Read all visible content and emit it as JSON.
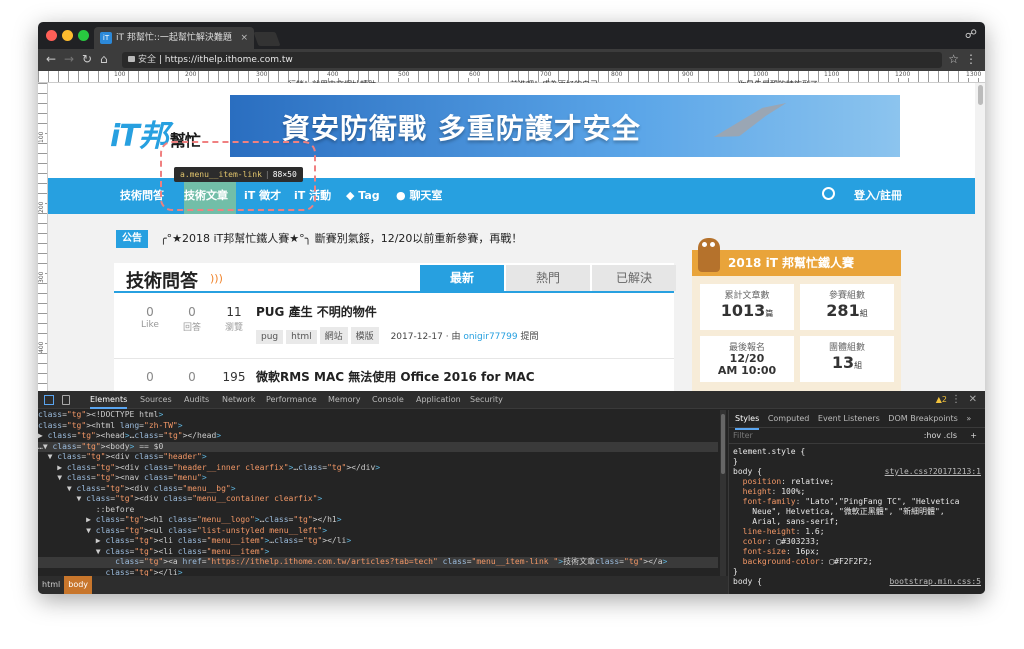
{
  "browser": {
    "tab_title": "iT 邦幫忙::一起幫忙解決難題",
    "url_secure": "安全",
    "url": "https://ithelp.ithome.com.tw",
    "traffic_colors": [
      "#ff5f57",
      "#febc2e",
      "#28c840"
    ]
  },
  "ruler": {
    "top_marks": [
      "100",
      "200",
      "300",
      "400",
      "500",
      "600",
      "700",
      "800",
      "900",
      "1000",
      "1100",
      "1200",
      "1300"
    ],
    "left_marks": [
      "100",
      "200",
      "300",
      "400"
    ],
    "text_left": "行銷！就用中文網址轉助",
    "text_mid": "前進吧！成為更好的自己",
    "text_right": "你是先覺醒的特族到了"
  },
  "site": {
    "logo_main": "iT邦",
    "logo_sub": "幫忙",
    "banner_text": "資安防衛戰 多重防護才安全",
    "nav": [
      "技術問答",
      "技術文章",
      "iT 徵才",
      "iT 活動",
      "Tag",
      "聊天室"
    ],
    "nav_login": "登入/註冊",
    "tooltip_selector": "a.menu__item-link",
    "tooltip_size": "88×50",
    "announce_badge": "公告",
    "announce_text": "╭°★2018 iT邦幫忙鐵人賽★°╮ 斷賽別氣餒，12/20以前重新參賽，再戰！",
    "main_title": "技術問答",
    "tabs": [
      "最新",
      "熱門",
      "已解決"
    ],
    "questions": [
      {
        "like": "0",
        "like_label": "Like",
        "answers": "0",
        "answers_label": "回答",
        "views": "11",
        "views_label": "瀏覽",
        "title": "PUG 產生 不明的物件",
        "tags": [
          "pug",
          "html",
          "網站",
          "模版"
        ],
        "meta_prefix": "2017-12-17 · 由",
        "author": "onigir77799",
        "meta_suffix": "提問"
      },
      {
        "like": "0",
        "answers": "0",
        "views": "195",
        "title": "微軟RMS MAC 無法使用 Office 2016 for MAC"
      }
    ],
    "ironman": {
      "title": "2018 iT 邦幫忙鐵人賽",
      "cards": [
        {
          "label": "累計文章數",
          "value": "1013",
          "unit": "篇"
        },
        {
          "label": "參賽組數",
          "value": "281",
          "unit": "組"
        },
        {
          "label": "最後報名",
          "value": "12/20",
          "value2": "AM 10:00"
        },
        {
          "label": "團體組數",
          "value": "13",
          "unit": "組"
        }
      ]
    }
  },
  "devtools": {
    "tabs": [
      "Elements",
      "Sources",
      "Audits",
      "Network",
      "Performance",
      "Memory",
      "Console",
      "Application",
      "Security"
    ],
    "warnings": "▲2",
    "dom": [
      "<!DOCTYPE html>",
      "<html lang=\"zh-TW\">",
      "▶ <head>…</head>",
      "…▼ <body> == $0",
      "  ▼ <div class=\"header\">",
      "    ▶ <div class=\"header__inner clearfix\">…</div>",
      "    ▼ <nav class=\"menu\">",
      "      ▼ <div class=\"menu__bg\">",
      "        ▼ <div class=\"menu__container clearfix\">",
      "            ::before",
      "          ▶ <h1 class=\"menu__logo\">…</h1>",
      "          ▼ <ul class=\"list-unstyled menu__left\">",
      "            ▶ <li class=\"menu__item\">…</li>",
      "            ▼ <li class=\"menu__item\">",
      "                <a href=\"https://ithelp.ithome.com.tw/articles?tab=tech\" class=\"menu__item-link \">技術文章</a>",
      "              </li>"
    ],
    "crumbs": [
      "html",
      "body"
    ],
    "styles_tabs": [
      "Styles",
      "Computed",
      "Event Listeners",
      "DOM Breakpoints",
      "»"
    ],
    "filter_placeholder": "Filter",
    "filter_hov": ":hov .cls",
    "filter_plus": "+",
    "styles_lines": [
      "element.style {",
      "}",
      "body {",
      "  position: relative;",
      "  height: 100%;",
      "  font-family: \"Lato\",\"PingFang TC\", \"Helvetica",
      "    Neue\", Helvetica, \"微軟正黑體\", \"新細明體\",",
      "    Arial, sans-serif;",
      "  line-height: 1.6;",
      "  color: ▢#303233;",
      "  font-size: 16px;",
      "  background-color: ▢#F2F2F2;",
      "}",
      "body {"
    ],
    "styles_link": "style.css?20171213:1",
    "styles_link2": "bootstrap.min.css:5"
  }
}
